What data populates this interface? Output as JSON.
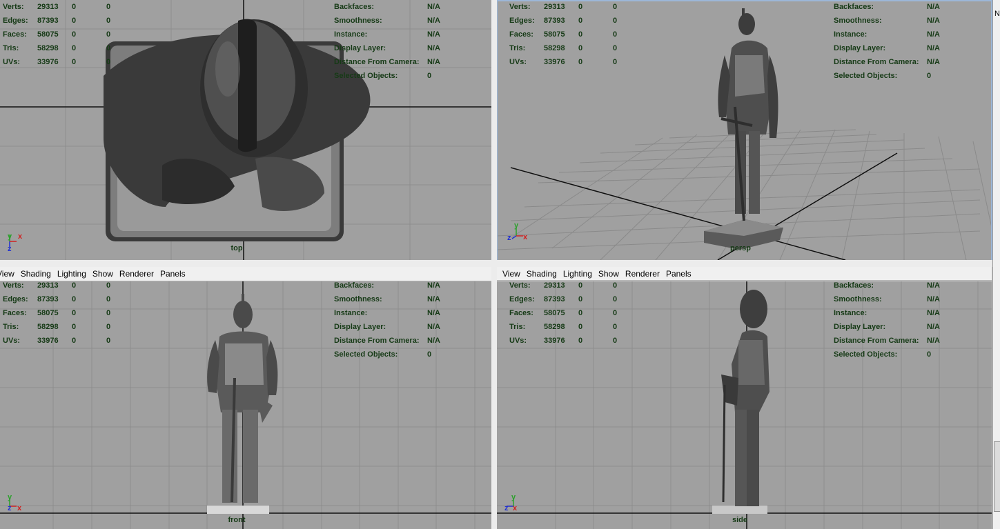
{
  "menu": [
    "View",
    "Shading",
    "Lighting",
    "Show",
    "Renderer",
    "Panels"
  ],
  "stats_labels": [
    "Verts:",
    "Edges:",
    "Faces:",
    "Tris:",
    "UVs:"
  ],
  "stats_values": [
    [
      "29313",
      "0",
      "0"
    ],
    [
      "87393",
      "0",
      "0"
    ],
    [
      "58075",
      "0",
      "0"
    ],
    [
      "58298",
      "0",
      "0"
    ],
    [
      "33976",
      "0",
      "0"
    ]
  ],
  "info_labels": [
    "Backfaces:",
    "Smoothness:",
    "Instance:",
    "Display Layer:",
    "Distance From Camera:",
    "Selected Objects:"
  ],
  "info_values": [
    "N/A",
    "N/A",
    "N/A",
    "N/A",
    "N/A",
    "0"
  ],
  "cameras": {
    "top": "top",
    "persp": "persp",
    "front": "front",
    "side": "side"
  },
  "axis_letters": {
    "x": "x",
    "y": "y",
    "z": "z"
  },
  "strip_tick": "N",
  "colors": {
    "viewport_bg": "#a0a0a0",
    "hud_text": "#163a16",
    "axis_x": "#d02020",
    "axis_y": "#2ca02c",
    "axis_z": "#2030d0",
    "selection_border": "#9cb7d8"
  }
}
